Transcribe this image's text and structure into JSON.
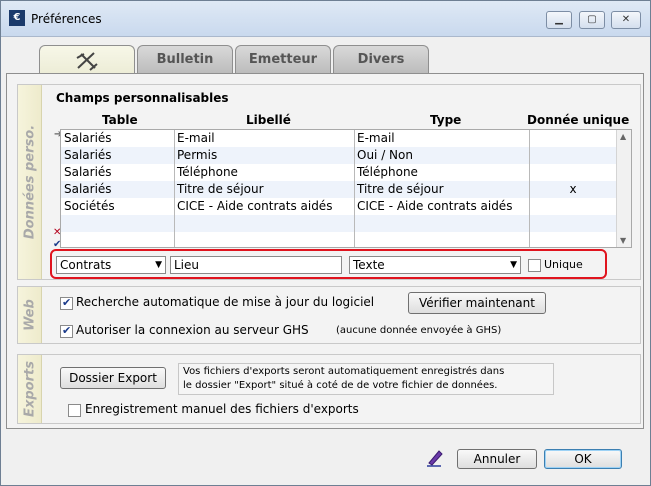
{
  "window": {
    "title": "Préférences",
    "app_icon_glyph": "€"
  },
  "tabs": [
    {
      "label": "",
      "icon": "tools-icon",
      "active": true
    },
    {
      "label": "Bulletin"
    },
    {
      "label": "Emetteur"
    },
    {
      "label": "Divers"
    }
  ],
  "custom_fields": {
    "side_label": "Données perso.",
    "title": "Champs personnalisables",
    "columns": [
      "Table",
      "Libellé",
      "Type",
      "Donnée unique"
    ],
    "rows": [
      [
        "Salariés",
        "E-mail",
        "E-mail",
        ""
      ],
      [
        "Salariés",
        "Permis",
        "Oui / Non",
        ""
      ],
      [
        "Salariés",
        "Téléphone",
        "Téléphone",
        ""
      ],
      [
        "Salariés",
        "Titre de séjour",
        "Titre de séjour",
        "x"
      ],
      [
        "Sociétés",
        "CICE - Aide contrats aidés",
        "CICE - Aide contrats aidés",
        ""
      ]
    ],
    "edit": {
      "table_value": "Contrats",
      "label_value": "Lieu",
      "type_value": "Texte",
      "unique_label": "Unique"
    }
  },
  "web": {
    "side_label": "Web",
    "auto_update_label": "Recherche automatique de mise à jour du logiciel",
    "check_now_label": "Vérifier maintenant",
    "allow_connection_label": "Autoriser la connexion au serveur GHS",
    "allow_connection_note": "(aucune donnée envoyée à GHS)"
  },
  "exports": {
    "side_label": "Exports",
    "folder_button_label": "Dossier Export",
    "note_line1": "Vos fichiers d'exports seront automatiquement enregistrés dans",
    "note_line2": "le dossier \"Export\" situé à coté de de votre fichier de données.",
    "manual_save_label": "Enregistrement manuel des fichiers d'exports"
  },
  "footer": {
    "cancel_label": "Annuler",
    "ok_label": "OK"
  }
}
